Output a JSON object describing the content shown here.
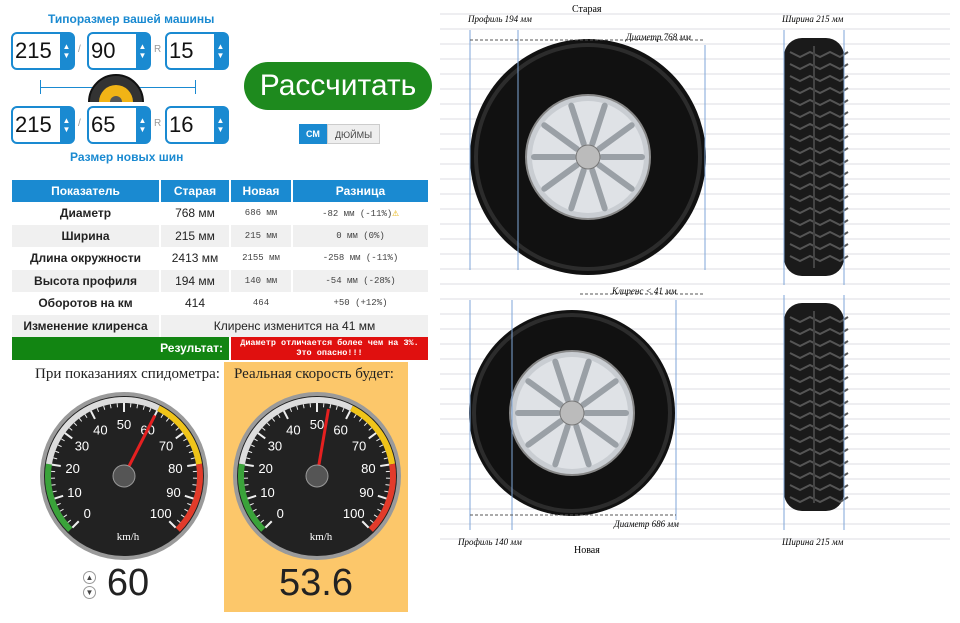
{
  "form": {
    "current_title": "Типоразмер вашей машины",
    "new_title": "Размер новых шин",
    "current": {
      "width": "215",
      "profile": "90",
      "r_label": "R",
      "rim": "15",
      "slash": "/"
    },
    "new": {
      "width": "215",
      "profile": "65",
      "r_label": "R",
      "rim": "16",
      "slash": "/"
    },
    "calc_button": "Рассчитать",
    "unit_cm": "СМ",
    "unit_in": "ДЮЙМЫ"
  },
  "table": {
    "headers": [
      "Показатель",
      "Старая",
      "Новая",
      "Разница"
    ],
    "rows": [
      {
        "label": "Диаметр",
        "old": "768 мм",
        "new": "686 мм",
        "diff": "-82 мм (-11%)"
      },
      {
        "label": "Ширина",
        "old": "215 мм",
        "new": "215 мм",
        "diff": "0 мм (0%)"
      },
      {
        "label": "Длина окружности",
        "old": "2413 мм",
        "new": "2155 мм",
        "diff": "-258 мм (-11%)"
      },
      {
        "label": "Высота профиля",
        "old": "194 мм",
        "new": "140 мм",
        "diff": "-54 мм (-28%)"
      },
      {
        "label": "Оборотов на км",
        "old": "414",
        "new": "464",
        "diff": "+50 (+12%)"
      }
    ],
    "clearance_label": "Изменение клиренса",
    "clearance_value": "Клиренс изменится на 41 мм",
    "result_label": "Результат:",
    "result_text": "Диаметр отличается более чем на 3%. Это опасно!!!"
  },
  "speed": {
    "speedo_label": "При показаниях спидометра:",
    "real_label": "Реальная скорость будет:",
    "speedo_value": "60",
    "real_value": "53.6",
    "unit": "km/h",
    "ticks": [
      "0",
      "10",
      "20",
      "30",
      "40",
      "50",
      "60",
      "70",
      "80",
      "90",
      "100"
    ]
  },
  "viz": {
    "old_title": "Старая",
    "new_title": "Новая",
    "old_profile": "Профиль 194 мм",
    "old_width": "Ширина 215 мм",
    "old_diameter": "Диаметр 768 мм",
    "clearance": "Клиренс < 41 мм",
    "new_profile": "Профиль 140 мм",
    "new_diameter": "Диаметр 686 мм",
    "new_width": "Ширина 215 мм"
  },
  "colors": {
    "accent": "#1a8ad1",
    "calc_green": "#1e8a1e",
    "danger": "#e0100f",
    "gauge_bg": "#fcc76a"
  }
}
